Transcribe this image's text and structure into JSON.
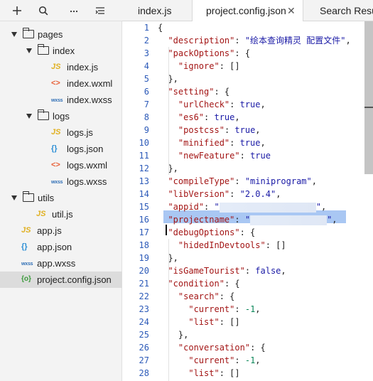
{
  "sidebar": {
    "toolbar": [
      {
        "icon": "plus-icon",
        "glyph": "+"
      },
      {
        "icon": "search-icon",
        "glyph": ""
      },
      {
        "icon": "more-icon",
        "glyph": "···"
      },
      {
        "icon": "collapse-icon",
        "glyph": ""
      }
    ],
    "tree": [
      {
        "label": "pages",
        "type": "folder",
        "level": 0,
        "expanded": true
      },
      {
        "label": "index",
        "type": "folder",
        "level": 1,
        "expanded": true
      },
      {
        "label": "index.js",
        "type": "js",
        "level": 2
      },
      {
        "label": "index.wxml",
        "type": "wxml",
        "level": 2
      },
      {
        "label": "index.wxss",
        "type": "wxss",
        "level": 2
      },
      {
        "label": "logs",
        "type": "folder",
        "level": 1,
        "expanded": true
      },
      {
        "label": "logs.js",
        "type": "js",
        "level": 2
      },
      {
        "label": "logs.json",
        "type": "json",
        "level": 2
      },
      {
        "label": "logs.wxml",
        "type": "wxml",
        "level": 2
      },
      {
        "label": "logs.wxss",
        "type": "wxss",
        "level": 2
      },
      {
        "label": "utils",
        "type": "folder",
        "level": 0,
        "expanded": true
      },
      {
        "label": "util.js",
        "type": "js",
        "level": 1
      },
      {
        "label": "app.js",
        "type": "js",
        "level": 0
      },
      {
        "label": "app.json",
        "type": "json",
        "level": 0
      },
      {
        "label": "app.wxss",
        "type": "wxss",
        "level": 0
      },
      {
        "label": "project.config.json",
        "type": "cfg",
        "level": 0,
        "selected": true
      }
    ],
    "icon_glyphs": {
      "js": "JS",
      "wxml": "<>",
      "wxss": "wxss",
      "json": "{}",
      "cfg": "{o}"
    }
  },
  "tabs": [
    {
      "label": "index.js",
      "active": false
    },
    {
      "label": "project.config.json",
      "active": true,
      "close": "✕"
    },
    {
      "label": "Search Results",
      "active": false
    }
  ],
  "editor": {
    "line_numbers": [
      "1",
      "2",
      "3",
      "4",
      "5",
      "6",
      "7",
      "8",
      "9",
      "10",
      "11",
      "12",
      "13",
      "14",
      "15",
      "16",
      "17",
      "18",
      "19",
      "20",
      "21",
      "22",
      "23",
      "24",
      "25",
      "26",
      "27",
      "28"
    ],
    "lines": [
      [
        [
          "p",
          "{"
        ]
      ],
      [
        [
          "p",
          "  "
        ],
        [
          "k",
          "\"description\""
        ],
        [
          "p",
          ": "
        ],
        [
          "s",
          "\"绘本查询精灵 配置文件\""
        ],
        [
          "p",
          ","
        ]
      ],
      [
        [
          "p",
          "  "
        ],
        [
          "k",
          "\"packOptions\""
        ],
        [
          "p",
          ": {"
        ]
      ],
      [
        [
          "p",
          "    "
        ],
        [
          "k",
          "\"ignore\""
        ],
        [
          "p",
          ": []"
        ]
      ],
      [
        [
          "p",
          "  },"
        ]
      ],
      [
        [
          "p",
          "  "
        ],
        [
          "k",
          "\"setting\""
        ],
        [
          "p",
          ": {"
        ]
      ],
      [
        [
          "p",
          "    "
        ],
        [
          "k",
          "\"urlCheck\""
        ],
        [
          "p",
          ": "
        ],
        [
          "b",
          "true"
        ],
        [
          "p",
          ","
        ]
      ],
      [
        [
          "p",
          "    "
        ],
        [
          "k",
          "\"es6\""
        ],
        [
          "p",
          ": "
        ],
        [
          "b",
          "true"
        ],
        [
          "p",
          ","
        ]
      ],
      [
        [
          "p",
          "    "
        ],
        [
          "k",
          "\"postcss\""
        ],
        [
          "p",
          ": "
        ],
        [
          "b",
          "true"
        ],
        [
          "p",
          ","
        ]
      ],
      [
        [
          "p",
          "    "
        ],
        [
          "k",
          "\"minified\""
        ],
        [
          "p",
          ": "
        ],
        [
          "b",
          "true"
        ],
        [
          "p",
          ","
        ]
      ],
      [
        [
          "p",
          "    "
        ],
        [
          "k",
          "\"newFeature\""
        ],
        [
          "p",
          ": "
        ],
        [
          "b",
          "true"
        ]
      ],
      [
        [
          "p",
          "  },"
        ]
      ],
      [
        [
          "p",
          "  "
        ],
        [
          "k",
          "\"compileType\""
        ],
        [
          "p",
          ": "
        ],
        [
          "s",
          "\"miniprogram\""
        ],
        [
          "p",
          ","
        ]
      ],
      [
        [
          "p",
          "  "
        ],
        [
          "k",
          "\"libVersion\""
        ],
        [
          "p",
          ": "
        ],
        [
          "s",
          "\"2.0.4\""
        ],
        [
          "p",
          ","
        ]
      ],
      [
        [
          "p",
          "  "
        ],
        [
          "k",
          "\"appid\""
        ],
        [
          "p",
          ": "
        ],
        [
          "s",
          "\""
        ],
        [
          "r",
          "136"
        ],
        [
          "s",
          "\""
        ],
        [
          "p",
          ","
        ]
      ],
      [
        [
          "p",
          "  "
        ],
        [
          "k",
          "\"projectname\""
        ],
        [
          "p",
          ": "
        ],
        [
          "s",
          "\""
        ],
        [
          "r",
          "108"
        ],
        [
          "s",
          "\""
        ],
        [
          "p",
          ","
        ]
      ],
      [
        [
          "p",
          "  "
        ],
        [
          "k",
          "\"debugOptions\""
        ],
        [
          "p",
          ": {"
        ]
      ],
      [
        [
          "p",
          "    "
        ],
        [
          "k",
          "\"hidedInDevtools\""
        ],
        [
          "p",
          ": []"
        ]
      ],
      [
        [
          "p",
          "  },"
        ]
      ],
      [
        [
          "p",
          "  "
        ],
        [
          "k",
          "\"isGameTourist\""
        ],
        [
          "p",
          ": "
        ],
        [
          "b",
          "false"
        ],
        [
          "p",
          ","
        ]
      ],
      [
        [
          "p",
          "  "
        ],
        [
          "k",
          "\"condition\""
        ],
        [
          "p",
          ": {"
        ]
      ],
      [
        [
          "p",
          "    "
        ],
        [
          "k",
          "\"search\""
        ],
        [
          "p",
          ": {"
        ]
      ],
      [
        [
          "p",
          "      "
        ],
        [
          "k",
          "\"current\""
        ],
        [
          "p",
          ": "
        ],
        [
          "n",
          "-1"
        ],
        [
          "p",
          ","
        ]
      ],
      [
        [
          "p",
          "      "
        ],
        [
          "k",
          "\"list\""
        ],
        [
          "p",
          ": []"
        ]
      ],
      [
        [
          "p",
          "    },"
        ]
      ],
      [
        [
          "p",
          "    "
        ],
        [
          "k",
          "\"conversation\""
        ],
        [
          "p",
          ": {"
        ]
      ],
      [
        [
          "p",
          "      "
        ],
        [
          "k",
          "\"current\""
        ],
        [
          "p",
          ": "
        ],
        [
          "n",
          "-1"
        ],
        [
          "p",
          ","
        ]
      ],
      [
        [
          "p",
          "      "
        ],
        [
          "k",
          "\"list\""
        ],
        [
          "p",
          ": []"
        ]
      ]
    ]
  },
  "colors": {
    "key": "#a31515",
    "string": "#1a1aa6",
    "number": "#098658",
    "line_number": "#2c5ab8",
    "selection": "#a9c7f3"
  }
}
